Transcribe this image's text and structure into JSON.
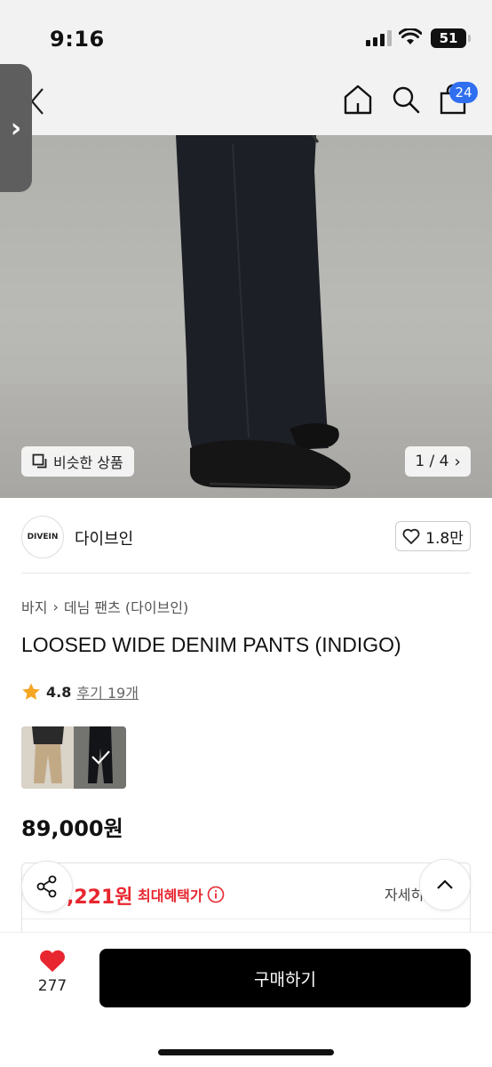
{
  "status": {
    "time": "9:16",
    "battery": "51"
  },
  "nav": {
    "cart_badge": "24"
  },
  "hero": {
    "similar_label": "비슷한 상품",
    "pager": "1 / 4"
  },
  "brand": {
    "logo_text": "DIVEIN",
    "name": "다이브인",
    "likes": "1.8만"
  },
  "breadcrumb": {
    "level1": "바지",
    "level2": "데님 팬츠 (다이브인)"
  },
  "product": {
    "title": "LOOSED WIDE DENIM PANTS (INDIGO)",
    "rating": "4.8",
    "reviews": "후기 19개",
    "price": "89,000원"
  },
  "benefit": {
    "price_partial": ",221원",
    "label": "최대혜택가",
    "detail": "자세히"
  },
  "bottom": {
    "wish_count": "277",
    "buy_label": "구매하기"
  },
  "colors": {
    "accent_blue": "#2f6ff0",
    "sale_red": "#e8262f",
    "heart_red": "#e8262f",
    "star": "#f5a623"
  }
}
